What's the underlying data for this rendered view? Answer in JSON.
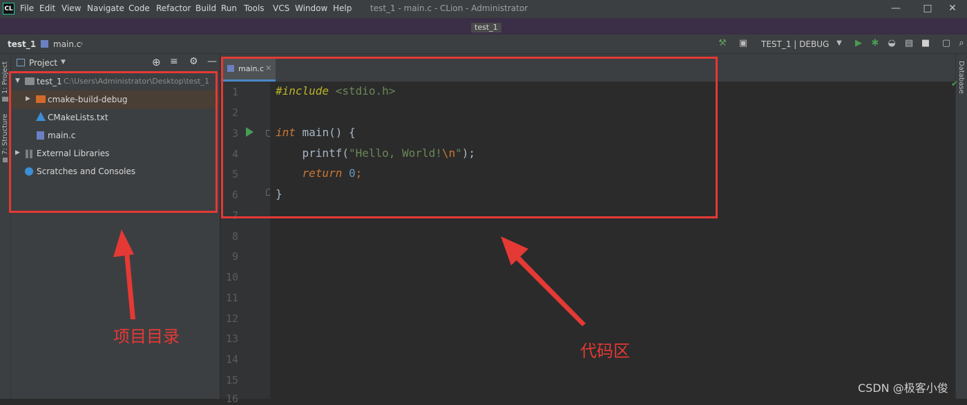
{
  "app": {
    "logo_text": "CL",
    "window_title": "test_1 - main.c - CLion - Administrator",
    "menu": [
      "File",
      "Edit",
      "View",
      "Navigate",
      "Code",
      "Refactor",
      "Build",
      "Run",
      "Tools",
      "VCS",
      "Window",
      "Help"
    ]
  },
  "project_strip": {
    "label": "test_1"
  },
  "navbar": {
    "crumb_project": "test_1",
    "crumb_file": "main.c",
    "run_config": "TEST_1 | DEBUG"
  },
  "left_strip": {
    "project_label": "1: Project",
    "structure_label": "7: Structure"
  },
  "right_strip": {
    "database_label": "Database"
  },
  "project_panel": {
    "title": "Project",
    "tree": [
      {
        "label": "test_1",
        "path": "C:\\Users\\Administrator\\Desktop\\test_1",
        "icon": "folder-icon",
        "expanded": true
      },
      {
        "label": "cmake-build-debug",
        "icon": "folder-orange-icon",
        "expanded": false,
        "selected": true
      },
      {
        "label": "CMakeLists.txt",
        "icon": "cmake-icon"
      },
      {
        "label": "main.c",
        "icon": "c-file-icon"
      },
      {
        "label": "External Libraries",
        "icon": "library-icon",
        "expanded": false
      },
      {
        "label": "Scratches and Consoles",
        "icon": "scratches-icon"
      }
    ]
  },
  "editor": {
    "tab_label": "main.c",
    "line_numbers": [
      "1",
      "2",
      "3",
      "4",
      "5",
      "6",
      "7",
      "8",
      "9",
      "10",
      "11",
      "12",
      "13",
      "14",
      "15",
      "16"
    ],
    "code": {
      "l1_directive": "#include",
      "l1_header": " <stdio.h>",
      "l3_type": "int",
      "l3_rest": " main() {",
      "l4_indent": "    ",
      "l4_func": "printf",
      "l4_open": "(",
      "l4_string": "\"Hello, World!",
      "l4_escape": "\\n",
      "l4_quote": "\"",
      "l4_close": ");",
      "l5_indent": "    ",
      "l5_keyword": "return",
      "l5_space": " ",
      "l5_number": "0",
      "l5_semi": ";",
      "l6_brace": "}"
    }
  },
  "annotations": {
    "project_dir": "项目目录",
    "code_area": "代码区"
  },
  "watermark": "CSDN @极客小俊",
  "colors": {
    "accent": "#4a88c7",
    "annotation_red": "#e53935",
    "keyword": "#cc7832",
    "directive": "#bbb529",
    "string": "#6a8759",
    "number": "#6897bb",
    "run_green": "#499c54"
  }
}
